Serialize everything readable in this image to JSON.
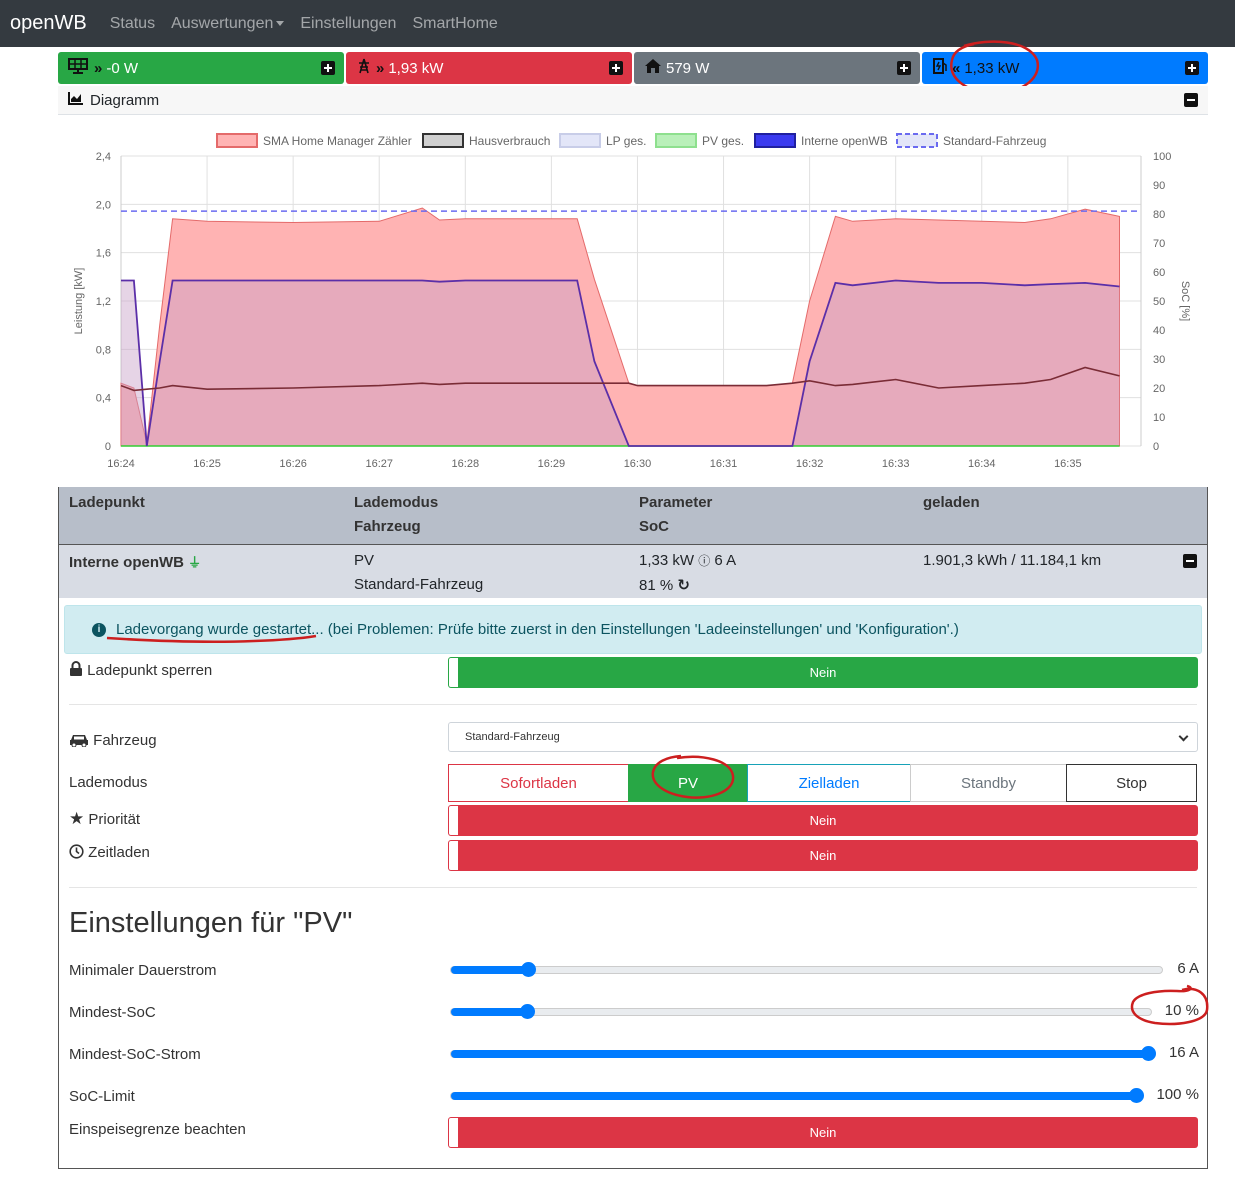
{
  "navbar": {
    "brand": "openWB",
    "items": [
      "Status",
      "Auswertungen",
      "Einstellungen",
      "SmartHome"
    ]
  },
  "tiles": [
    {
      "value": "-0 W",
      "color": "#28a745",
      "icon": "solar-panel-icon"
    },
    {
      "value": "1,93 kW",
      "color": "#dc3545",
      "icon": "grid-tower-icon"
    },
    {
      "value": "579 W",
      "color": "#6c757d",
      "icon": "house-icon"
    },
    {
      "value": "1,33 kW",
      "color": "#007bff",
      "icon": "charging-station-icon"
    }
  ],
  "diagram": {
    "title": "Diagramm"
  },
  "chart_data": {
    "type": "area",
    "legend": [
      "SMA Home Manager Zähler",
      "Hausverbrauch",
      "LP ges.",
      "PV ges.",
      "Interne openWB",
      "Standard-Fahrzeug"
    ],
    "legend_position": "top",
    "ylabel": "Leistung [kW]",
    "y2label": "SoC [%]",
    "ylim": [
      0,
      2.4
    ],
    "y2lim": [
      0,
      100
    ],
    "yticks": [
      "2,4",
      "2,0",
      "1,6",
      "1,2",
      "0,8",
      "0,4",
      "0"
    ],
    "y2ticks": [
      "100",
      "90",
      "80",
      "70",
      "60",
      "50",
      "40",
      "30",
      "20",
      "10",
      "0"
    ],
    "xticks": [
      "16:24",
      "16:25",
      "16:26",
      "16:27",
      "16:28",
      "16:29",
      "16:30",
      "16:31",
      "16:32",
      "16:33",
      "16:34",
      "16:35"
    ],
    "grid": true,
    "x_minutes": [
      0,
      0.15,
      0.3,
      0.45,
      0.6,
      1.0,
      2.0,
      3.0,
      3.5,
      3.7,
      4.0,
      5.0,
      5.3,
      5.5,
      5.9,
      6.0,
      6.5,
      7.0,
      7.5,
      7.8,
      8.0,
      8.3,
      8.5,
      9.0,
      9.5,
      10.0,
      10.5,
      10.8,
      11.2,
      11.6
    ],
    "series": [
      {
        "name": "SMA Home Manager Zähler",
        "color": "#ff9999",
        "values": [
          0.52,
          0.48,
          0.02,
          1.0,
          1.88,
          1.86,
          1.85,
          1.86,
          1.97,
          1.87,
          1.88,
          1.88,
          1.88,
          1.38,
          0.52,
          0.5,
          0.5,
          0.5,
          0.5,
          0.52,
          1.2,
          1.9,
          1.86,
          1.88,
          1.87,
          1.86,
          1.85,
          1.88,
          1.96,
          1.9
        ]
      },
      {
        "name": "Hausverbrauch",
        "color": "#7a2c36",
        "values": [
          0.5,
          0.46,
          0.47,
          0.48,
          0.5,
          0.47,
          0.48,
          0.5,
          0.52,
          0.51,
          0.52,
          0.52,
          0.52,
          0.52,
          0.52,
          0.5,
          0.5,
          0.5,
          0.5,
          0.52,
          0.54,
          0.5,
          0.51,
          0.55,
          0.48,
          0.5,
          0.52,
          0.55,
          0.65,
          0.58
        ]
      },
      {
        "name": "LP ges.",
        "color": "#c8cde8",
        "values": [
          1.37,
          1.37,
          0.0,
          0.7,
          1.37,
          1.37,
          1.37,
          1.37,
          1.37,
          1.36,
          1.37,
          1.37,
          1.37,
          0.7,
          0.0,
          0.0,
          0.0,
          0.0,
          0.0,
          0.0,
          0.7,
          1.35,
          1.33,
          1.37,
          1.35,
          1.35,
          1.33,
          1.34,
          1.35,
          1.32
        ]
      },
      {
        "name": "PV ges.",
        "color": "#33cc33",
        "values": [
          0,
          0,
          0,
          0,
          0,
          0,
          0,
          0,
          0,
          0,
          0,
          0,
          0,
          0,
          0,
          0,
          0,
          0,
          0,
          0,
          0,
          0,
          0,
          0,
          0,
          0,
          0,
          0,
          0,
          0
        ]
      },
      {
        "name": "Interne openWB",
        "color": "#5b2fa8",
        "values": [
          1.37,
          1.37,
          0.0,
          0.7,
          1.37,
          1.37,
          1.37,
          1.37,
          1.37,
          1.36,
          1.37,
          1.37,
          1.37,
          0.7,
          0.0,
          0.0,
          0.0,
          0.0,
          0.0,
          0.0,
          0.7,
          1.35,
          1.33,
          1.37,
          1.35,
          1.35,
          1.33,
          1.34,
          1.35,
          1.32
        ]
      },
      {
        "name": "Standard-Fahrzeug",
        "color": "#6a6af0",
        "values_soc": 81
      }
    ]
  },
  "ladepunkt": {
    "headers": {
      "col1": "Ladepunkt",
      "col2a": "Lademodus",
      "col2b": "Fahrzeug",
      "col3a": "Parameter",
      "col3b": "SoC",
      "col4": "geladen"
    },
    "row": {
      "name": "Interne openWB",
      "mode": "PV",
      "vehicle": "Standard-Fahrzeug",
      "power": "1,33 kW",
      "current": "6 A",
      "soc": "81 %",
      "charged": "1.901,3 kWh / 11.184,1 km"
    },
    "alert": {
      "link": "Ladevorgang wurde gestartet...",
      "text": " (bei Problemen: Prüfe bitte zuerst in den Einstellungen 'Ladeeinstellungen' und 'Konfiguration'.)"
    },
    "lock": {
      "label": "Ladepunkt sperren",
      "value": "Nein"
    },
    "vehicle_select": {
      "label": "Fahrzeug",
      "value": "Standard-Fahrzeug"
    },
    "modes": {
      "label": "Lademodus",
      "items": [
        "Sofortladen",
        "PV",
        "Zielladen",
        "Standby",
        "Stop"
      ],
      "active": "PV"
    },
    "priority": {
      "label": "Priorität",
      "value": "Nein"
    },
    "timer": {
      "label": "Zeitladen",
      "value": "Nein"
    },
    "settings_title": "Einstellungen für \"PV\"",
    "sliders": [
      {
        "label": "Minimaler Dauerstrom",
        "value": "6 A",
        "fraction": 0.1
      },
      {
        "label": "Mindest-SoC",
        "value": "10 %",
        "fraction": 0.1
      },
      {
        "label": "Mindest-SoC-Strom",
        "value": "16 A",
        "fraction": 1.0
      },
      {
        "label": "SoC-Limit",
        "value": "100 %",
        "fraction": 1.0
      }
    ],
    "feed_in": {
      "label": "Einspeisegrenze beachten",
      "value": "Nein"
    }
  }
}
